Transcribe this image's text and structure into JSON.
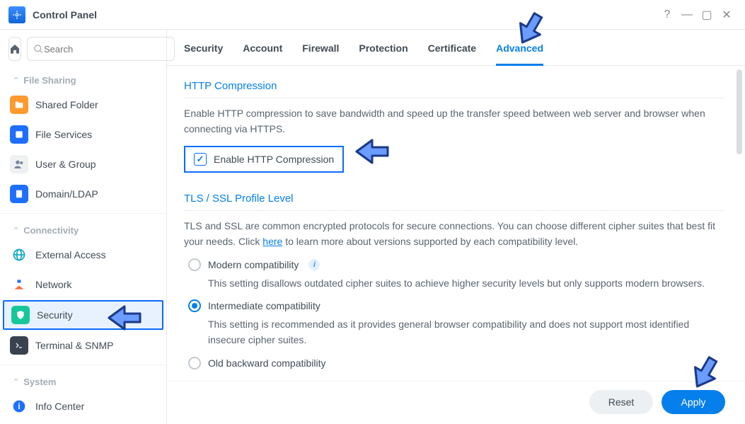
{
  "window": {
    "title": "Control Panel"
  },
  "search": {
    "placeholder": "Search"
  },
  "sidebar": {
    "groups": [
      {
        "label": "File Sharing",
        "items": [
          {
            "name": "shared-folder",
            "label": "Shared Folder",
            "color": "#ff9a2e"
          },
          {
            "name": "file-services",
            "label": "File Services",
            "color": "#1f6fff"
          },
          {
            "name": "user-group",
            "label": "User & Group",
            "color": "#7a8799"
          },
          {
            "name": "domain-ldap",
            "label": "Domain/LDAP",
            "color": "#1f6fff"
          }
        ]
      },
      {
        "label": "Connectivity",
        "items": [
          {
            "name": "external-access",
            "label": "External Access",
            "color": "#0aa6c8"
          },
          {
            "name": "network",
            "label": "Network",
            "color": "#ff6a3d"
          },
          {
            "name": "security",
            "label": "Security",
            "color": "#16c79a",
            "active": true
          },
          {
            "name": "terminal-snmp",
            "label": "Terminal & SNMP",
            "color": "#3a4250"
          }
        ]
      },
      {
        "label": "System",
        "items": [
          {
            "name": "info-center",
            "label": "Info Center",
            "color": "#1f6fff"
          }
        ]
      }
    ]
  },
  "tabs": [
    {
      "id": "security",
      "label": "Security"
    },
    {
      "id": "account",
      "label": "Account"
    },
    {
      "id": "firewall",
      "label": "Firewall"
    },
    {
      "id": "protection",
      "label": "Protection"
    },
    {
      "id": "certificate",
      "label": "Certificate"
    },
    {
      "id": "advanced",
      "label": "Advanced",
      "active": true
    }
  ],
  "sections": {
    "http_compression": {
      "title": "HTTP Compression",
      "desc": "Enable HTTP compression to save bandwidth and speed up the transfer speed between web server and browser when connecting via HTTPS.",
      "checkbox_label": "Enable HTTP Compression",
      "checked": true
    },
    "tls": {
      "title": "TLS / SSL Profile Level",
      "desc_prefix": "TLS and SSL are common encrypted protocols for secure connections. You can choose different cipher suites that best fit your needs. Click ",
      "desc_link": "here",
      "desc_suffix": " to learn more about versions supported by each compatibility level.",
      "options": [
        {
          "id": "modern",
          "label": "Modern compatibility",
          "info": true,
          "desc": "This setting disallows outdated cipher suites to achieve higher security levels but only supports modern browsers.",
          "selected": false
        },
        {
          "id": "intermediate",
          "label": "Intermediate compatibility",
          "desc": "This setting is recommended as it provides general browser compatibility and does not support most identified insecure cipher suites.",
          "selected": true
        },
        {
          "id": "old",
          "label": "Old backward compatibility",
          "desc": "",
          "selected": false
        }
      ]
    }
  },
  "footer": {
    "reset": "Reset",
    "apply": "Apply"
  }
}
